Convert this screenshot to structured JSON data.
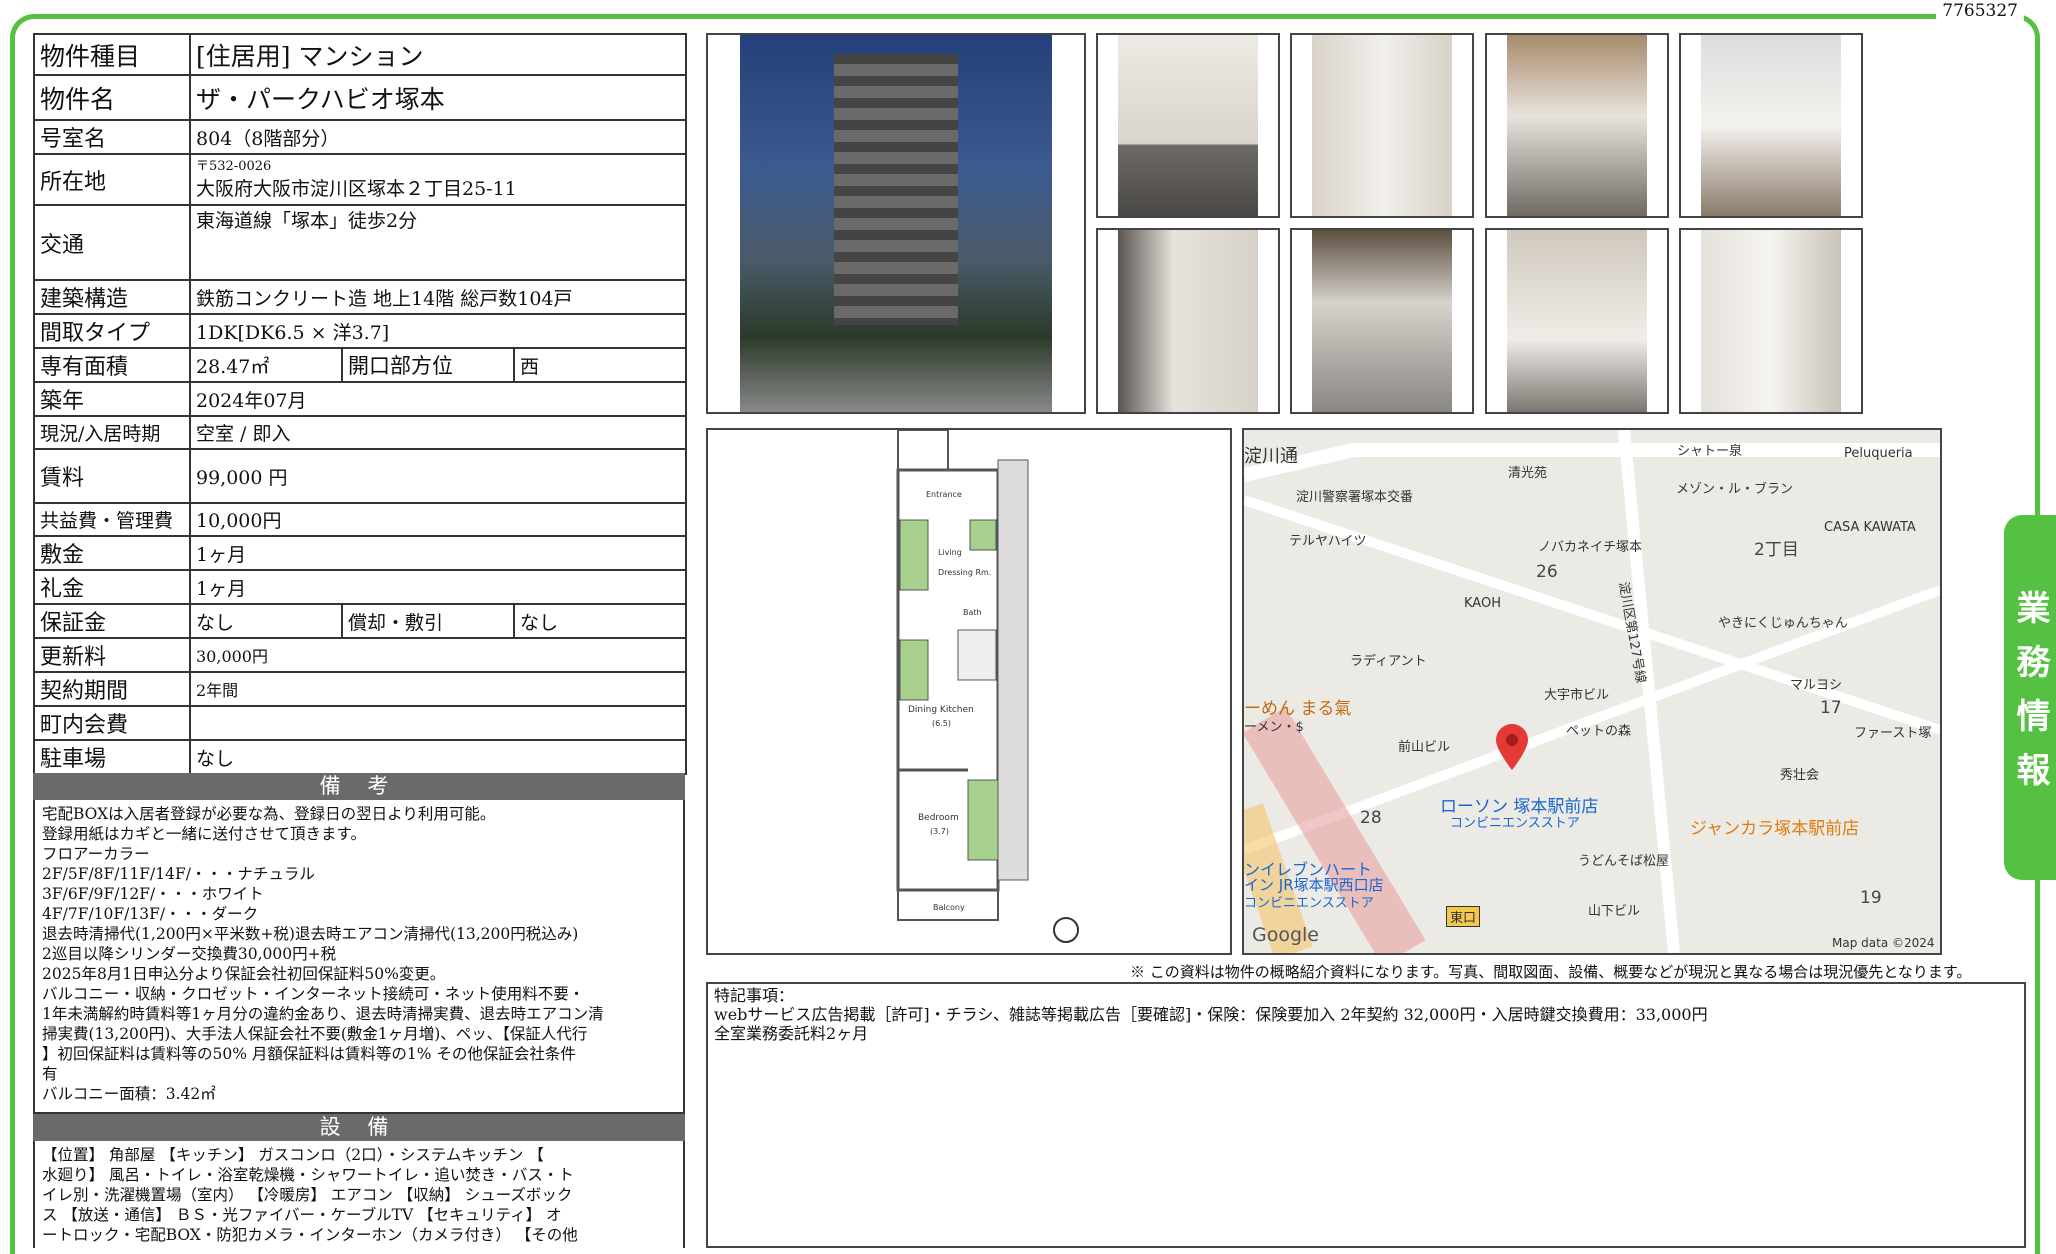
{
  "doc_id": "7765327",
  "side_tab": "業務情報",
  "spec": {
    "type_label": "物件種目",
    "type_value": "[住居用] マンション",
    "name_label": "物件名",
    "name_value": "ザ・パークハビオ塚本",
    "room_label": "号室名",
    "room_value": "804（8階部分）",
    "address_label": "所在地",
    "address_zip": "〒532-0026",
    "address_value": "大阪府大阪市淀川区塚本２丁目25-11",
    "transit_label": "交通",
    "transit_value": "東海道線「塚本」徒歩2分",
    "structure_label": "建築構造",
    "structure_value": "鉄筋コンクリート造 地上14階 総戸数104戸",
    "layout_label": "間取タイプ",
    "layout_value": "1DK[DK6.5 × 洋3.7]",
    "area_label": "専有面積",
    "area_value": "28.47㎡",
    "direction_label": "開口部方位",
    "direction_value": "西",
    "built_label": "築年",
    "built_value": "2024年07月",
    "status_label": "現況/入居時期",
    "status_value": "空室 / 即入",
    "rent_label": "賃料",
    "rent_value": "99,000 円",
    "fee_label": "共益費・管理費",
    "fee_value": "10,000円",
    "deposit_label": "敷金",
    "deposit_value": "1ヶ月",
    "key_money_label": "礼金",
    "key_money_value": "1ヶ月",
    "guarantee_label": "保証金",
    "guarantee_value": "なし",
    "amort_label": "償却・敷引",
    "amort_value": "なし",
    "renewal_label": "更新料",
    "renewal_value": "30,000円",
    "contract_label": "契約期間",
    "contract_value": "2年間",
    "community_label": "町内会費",
    "community_value": "",
    "parking_label": "駐車場",
    "parking_value": "なし"
  },
  "biko": {
    "heading": "備 考",
    "lines": [
      "宅配BOXは入居者登録が必要な為、登録日の翌日より利用可能。",
      "登録用紙はカギと一緒に送付させて頂きます。",
      "フロアーカラー",
      "2F/5F/8F/11F/14F/・・・ナチュラル",
      "3F/6F/9F/12F/・・・ホワイト",
      "4F/7F/10F/13F/・・・ダーク",
      "退去時清掃代(1,200円×平米数+税)退去時エアコン清掃代(13,200円税込み)",
      "2巡目以降シリンダー交換費30,000円+税",
      "2025年8月1日申込分より保証会社初回保証料50%変更。",
      "バルコニー・収納・クロゼット・インターネット接続可・ネット使用料不要・",
      "1年未満解約時賃料等1ヶ月分の違約金あり、退去時清掃実費、退去時エアコン清",
      "掃実費(13,200円)、大手法人保証会社不要(敷金1ヶ月増)、ペッ、【保証人代行",
      "】初回保証料は賃料等の50% 月額保証料は賃料等の1% その他保証会社条件",
      "有",
      "バルコニー面積：3.42㎡"
    ]
  },
  "setsubi": {
    "heading": "設 備",
    "lines": [
      "【位置】 角部屋 【キッチン】 ガスコンロ（2口）・システムキッチン 【",
      "水廻り】 風呂・トイレ・浴室乾燥機・シャワートイレ・追い焚き・バス・ト",
      "イレ別・洗濯機置場（室内） 【冷暖房】 エアコン 【収納】 シューズボック",
      "ス 【放送・通信】 ＢＳ・光ファイバー・ケーブルTV 【セキュリティ】 オ",
      "ートロック・宅配BOX・防犯カメラ・インターホン（カメラ付き） 【その他"
    ]
  },
  "floor_plan": {
    "rooms": [
      "Entrance",
      "Living",
      "Dressing Rm.",
      "Bath",
      "Dining Kitchen",
      "(6.5)",
      "Bedroom",
      "(3.7)",
      "Balcony"
    ]
  },
  "map": {
    "labels": [
      "淀川通",
      "淀川警察署塚本交番",
      "清光苑",
      "シャトー泉",
      "Peluqueria",
      "メゾン・ル・ブラン",
      "CASA KAWATA",
      "テルヤハイツ",
      "ノバカネイチ塚本",
      "淀川区第127号線",
      "2丁目",
      "KAOH",
      "やきにくじゅんちゃん",
      "ラディアント",
      "大宇市ビル",
      "マルヨシ",
      "ーめん まる氣",
      "ーメン・$",
      "前山ビル",
      "ペットの森",
      "ファースト塚",
      "秀壮会",
      "ジャンカラ塚本駅前店",
      "うどんそば松屋",
      "ンイレブンハート",
      "イン JR塚本駅西口店",
      "コンビニエンスストア",
      "東口",
      "山下ビル",
      "Google",
      "Map data ©2024"
    ],
    "store": "ローソン 塚本駅前店",
    "store_sub": "コンビニエンスストア",
    "numbers": [
      "26",
      "17",
      "28",
      "19"
    ]
  },
  "disclaimer": "※ この資料は物件の概略紹介資料になります。写真、間取図面、設備、概要などが現況と異なる場合は現況優先となります。",
  "remarks": {
    "title": "特記事項：",
    "line1": "webサービス広告掲載［許可]・チラシ、雑誌等掲載広告［要確認]・保険：保険要加入 2年契約 32,000円・入居時鍵交換費用：33,000円",
    "line2": "全室業務委託料2ヶ月"
  },
  "photos": [
    "building-exterior",
    "room-entrance",
    "room-closet",
    "kitchen",
    "washroom",
    "hallway",
    "toilet",
    "shoe-cabinet",
    "laundry-space"
  ]
}
